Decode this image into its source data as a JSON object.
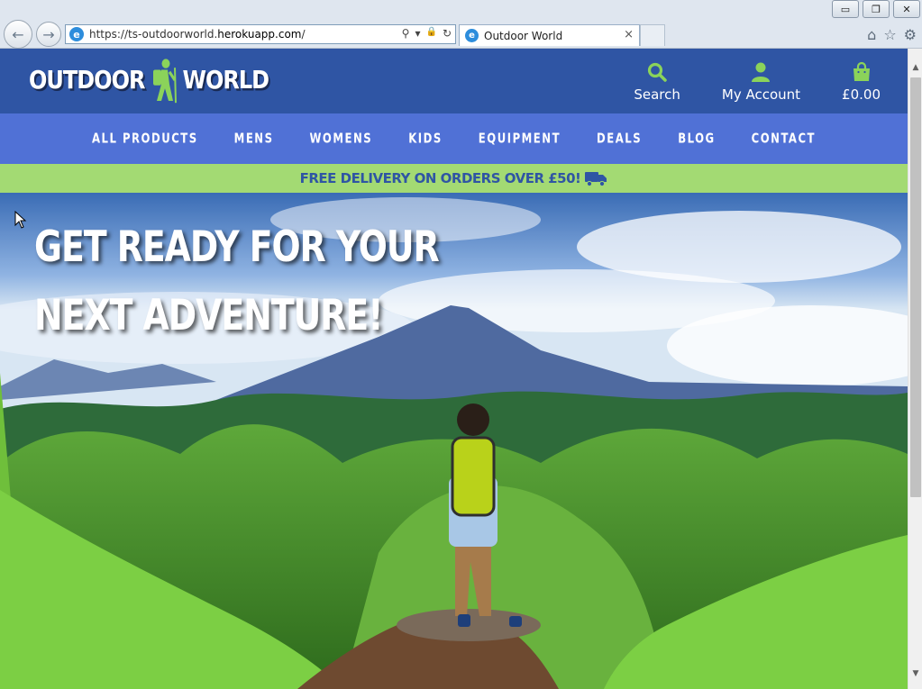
{
  "browser": {
    "url_prefix": "https://ts-outdoorworld.",
    "url_host": "herokuapp.com",
    "url_suffix": "/",
    "tab_title": "Outdoor World",
    "window_minimize": "▭",
    "window_restore": "❐",
    "window_close": "✕",
    "back_icon": "←",
    "forward_icon": "→",
    "tab_close": "×",
    "search_glyph": "⚲",
    "dropdown_glyph": "▾",
    "lock_glyph": "🔒",
    "refresh_glyph": "↻",
    "home_glyph": "⌂",
    "favorites_glyph": "☆",
    "settings_glyph": "⚙"
  },
  "header": {
    "logo_left": "OUTDOOR",
    "logo_right": "WORLD",
    "actions": [
      {
        "label": "Search",
        "icon": "search-icon"
      },
      {
        "label": "My Account",
        "icon": "user-icon"
      },
      {
        "label": "£0.00",
        "icon": "shopping-bag-icon"
      }
    ]
  },
  "nav": {
    "items": [
      "ALL PRODUCTS",
      "MENS",
      "WOMENS",
      "KIDS",
      "EQUIPMENT",
      "DEALS",
      "BLOG",
      "CONTACT"
    ]
  },
  "promo": {
    "text": "FREE DELIVERY ON ORDERS OVER £50!",
    "icon": "truck-icon"
  },
  "hero": {
    "line1": "GET READY FOR YOUR",
    "line2": "NEXT ADVENTURE!"
  },
  "colors": {
    "header_bg": "#2f55a4",
    "nav_bg": "#5071d6",
    "promo_bg": "#a3da73",
    "accent_green": "#8bd35a"
  }
}
